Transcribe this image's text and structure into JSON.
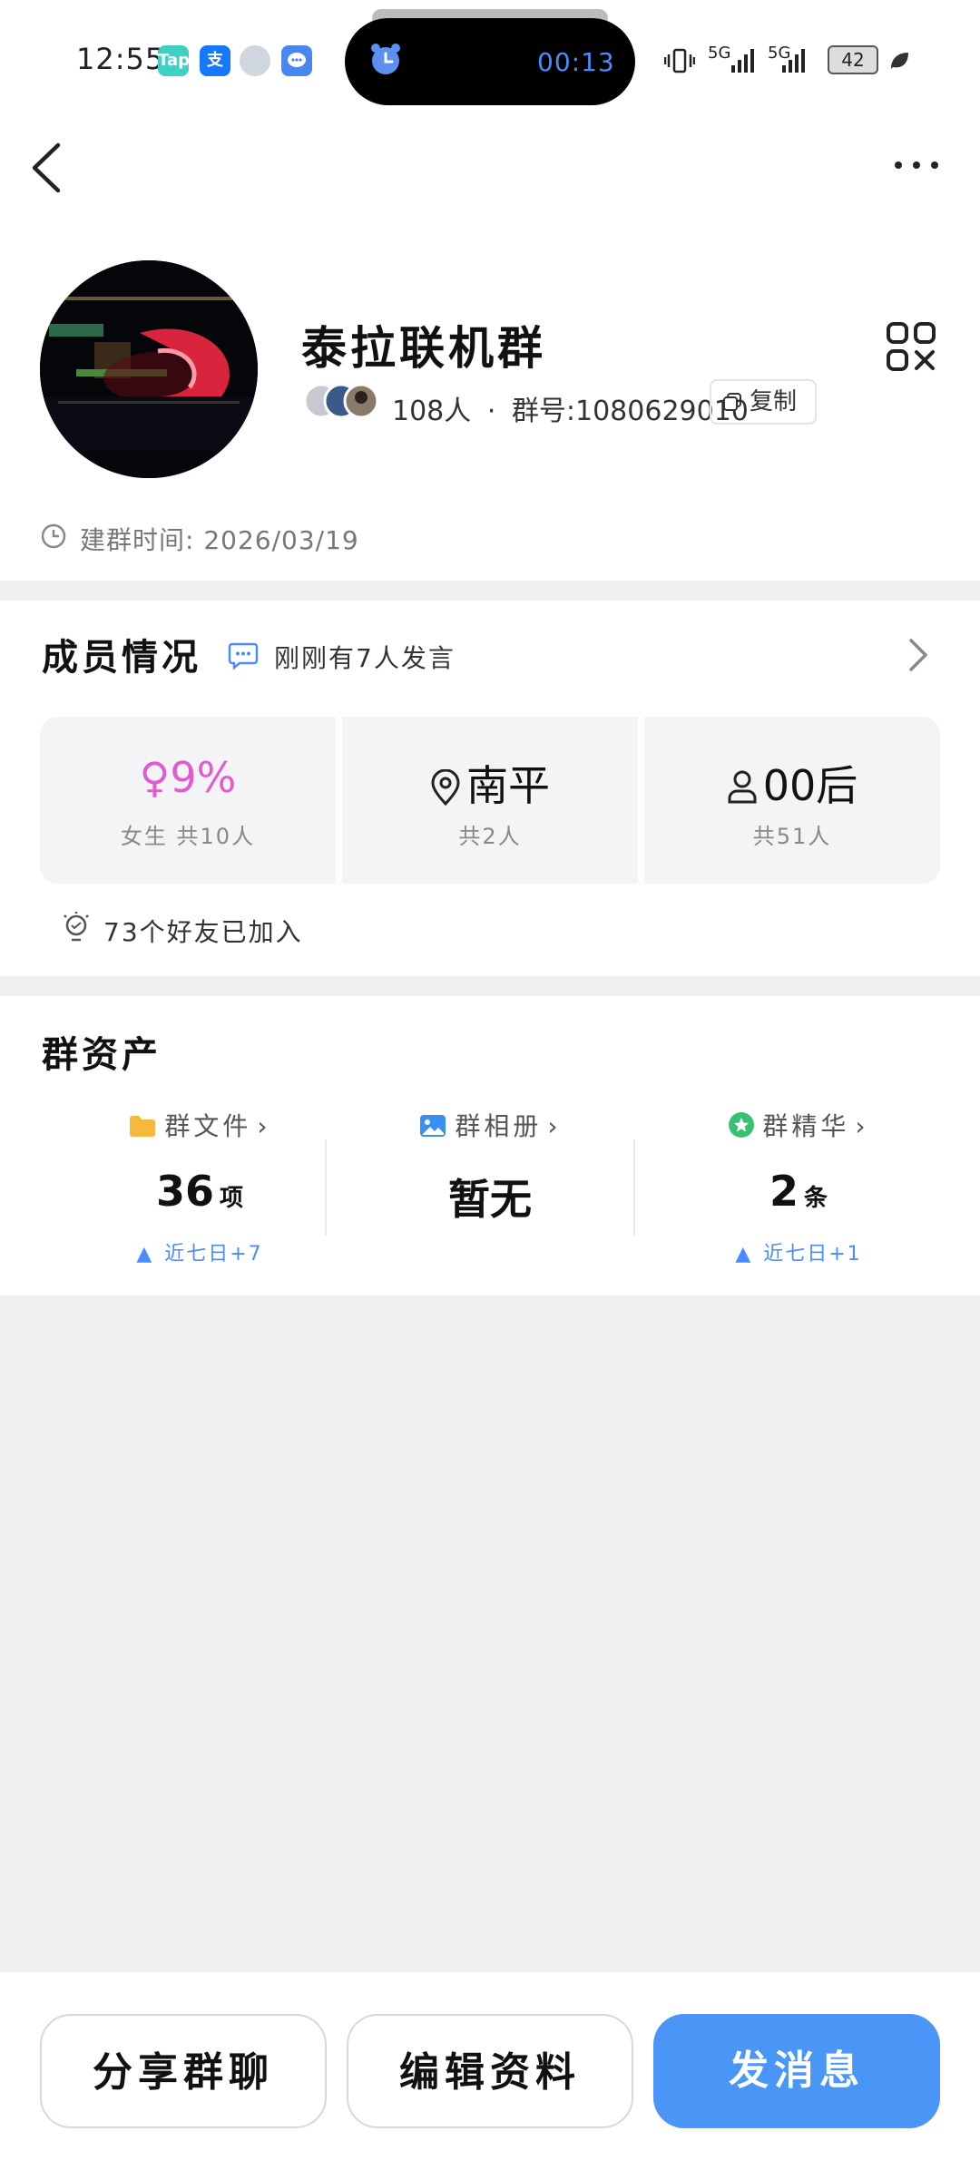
{
  "status_bar": {
    "time": "12:55",
    "timer": "00:13",
    "battery": "42",
    "signal1": "5G",
    "signal2": "5G",
    "tap_label": "Tap",
    "alipay_label": "支"
  },
  "group": {
    "name": "泰拉联机群",
    "member_count": "108人",
    "separator": "·",
    "group_number": "群号:1080629010",
    "copy_label": "复制",
    "created": "建群时间: 2026/03/19"
  },
  "members_section": {
    "title": "成员情况",
    "activity": "刚刚有7人发言",
    "stats": [
      {
        "main": "9%",
        "sub": "女生 共10人",
        "icon": "female-icon"
      },
      {
        "main": "南平",
        "sub": "共2人",
        "icon": "location-icon"
      },
      {
        "main": "00后",
        "sub": "共51人",
        "icon": "person-icon"
      }
    ],
    "friends_joined": "73个好友已加入"
  },
  "assets_section": {
    "title": "群资产",
    "items": [
      {
        "label": "群文件",
        "value": "36",
        "unit": "项",
        "trend": "近七日+7",
        "icon": "folder-icon"
      },
      {
        "label": "群相册",
        "value": "暂无",
        "unit": "",
        "trend": "",
        "icon": "image-icon"
      },
      {
        "label": "群精华",
        "value": "2",
        "unit": "条",
        "trend": "近七日+1",
        "icon": "star-icon"
      }
    ]
  },
  "bottom_bar": {
    "share": "分享群聊",
    "edit": "编辑资料",
    "send": "发消息"
  },
  "colors": {
    "accent": "#4a96f7",
    "female": "#e05bd0",
    "trend": "#4a8bff",
    "background": "#eeeff1"
  }
}
